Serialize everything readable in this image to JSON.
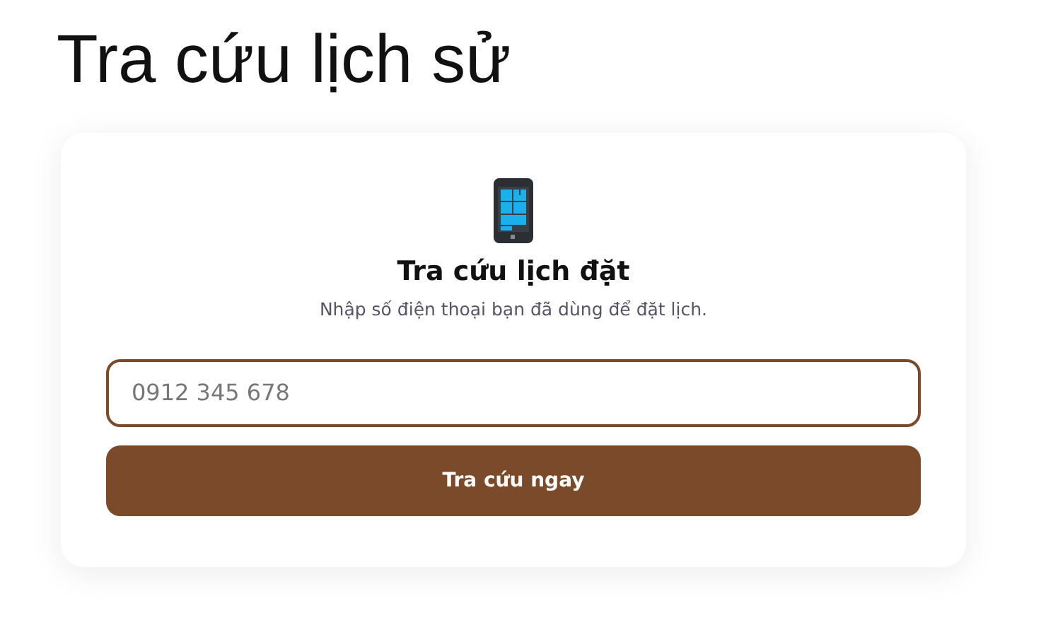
{
  "page": {
    "title": "Tra cứu lịch sử"
  },
  "card": {
    "heading": "Tra cứu lịch đặt",
    "description": "Nhập số điện thoại bạn đã dùng để đặt lịch.",
    "phone_field": {
      "placeholder": "0912 345 678"
    },
    "submit_button": "Tra cứu ngay"
  }
}
